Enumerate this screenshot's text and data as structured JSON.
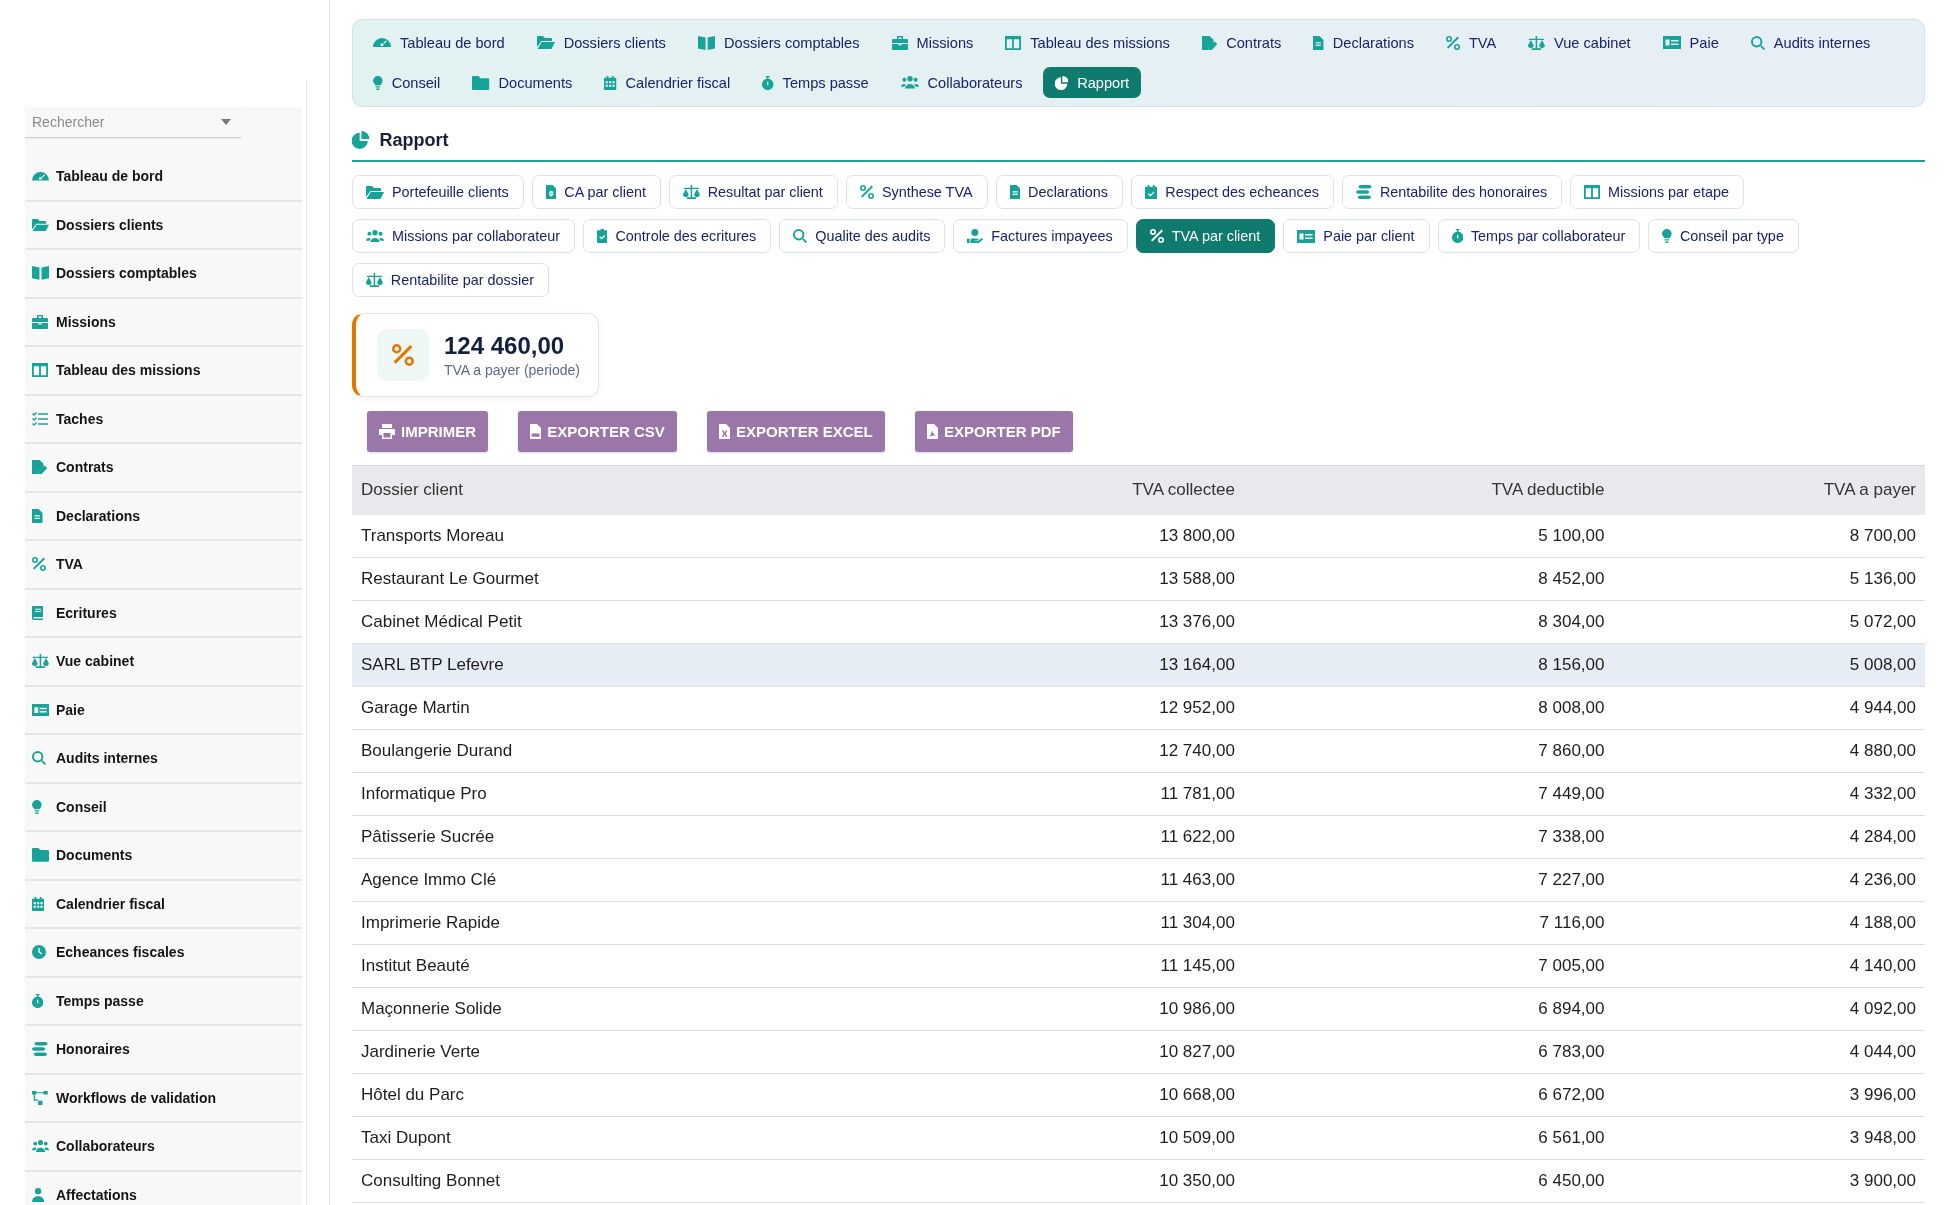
{
  "sidebar": {
    "search": {
      "placeholder": "Rechercher"
    },
    "items": [
      {
        "label": "Tableau de bord",
        "selected": false
      },
      {
        "label": "Dossiers clients",
        "selected": false
      },
      {
        "label": "Dossiers comptables",
        "selected": false
      },
      {
        "label": "Missions",
        "selected": false
      },
      {
        "label": "Tableau des missions",
        "selected": false
      },
      {
        "label": "Taches",
        "selected": false
      },
      {
        "label": "Contrats",
        "selected": false
      },
      {
        "label": "Declarations",
        "selected": false
      },
      {
        "label": "TVA",
        "selected": false
      },
      {
        "label": "Ecritures",
        "selected": false
      },
      {
        "label": "Vue cabinet",
        "selected": false
      },
      {
        "label": "Paie",
        "selected": false
      },
      {
        "label": "Audits internes",
        "selected": false
      },
      {
        "label": "Conseil",
        "selected": false
      },
      {
        "label": "Documents",
        "selected": false
      },
      {
        "label": "Calendrier fiscal",
        "selected": false
      },
      {
        "label": "Echeances fiscales",
        "selected": false
      },
      {
        "label": "Temps passe",
        "selected": false
      },
      {
        "label": "Honoraires",
        "selected": false
      },
      {
        "label": "Workflows de validation",
        "selected": false
      },
      {
        "label": "Collaborateurs",
        "selected": false
      },
      {
        "label": "Affectations",
        "selected": false
      }
    ]
  },
  "top_nav": {
    "items": [
      {
        "label": "Tableau de bord",
        "selected": false
      },
      {
        "label": "Dossiers clients",
        "selected": false
      },
      {
        "label": "Dossiers comptables",
        "selected": false
      },
      {
        "label": "Missions",
        "selected": false
      },
      {
        "label": "Tableau des missions",
        "selected": false
      },
      {
        "label": "Contrats",
        "selected": false
      },
      {
        "label": "Declarations",
        "selected": false
      },
      {
        "label": "TVA",
        "selected": false
      },
      {
        "label": "Vue cabinet",
        "selected": false
      },
      {
        "label": "Paie",
        "selected": false
      },
      {
        "label": "Audits internes",
        "selected": false
      },
      {
        "label": "Conseil",
        "selected": false
      },
      {
        "label": "Documents",
        "selected": false
      },
      {
        "label": "Calendrier fiscal",
        "selected": false
      },
      {
        "label": "Temps passe",
        "selected": false
      },
      {
        "label": "Collaborateurs",
        "selected": false
      },
      {
        "label": "Rapport",
        "selected": true
      }
    ]
  },
  "section": {
    "title": "Rapport"
  },
  "report_tabs": [
    {
      "label": "Portefeuille clients",
      "selected": false
    },
    {
      "label": "CA par client",
      "selected": false
    },
    {
      "label": "Resultat par client",
      "selected": false
    },
    {
      "label": "Synthese TVA",
      "selected": false
    },
    {
      "label": "Declarations",
      "selected": false
    },
    {
      "label": "Respect des echeances",
      "selected": false
    },
    {
      "label": "Rentabilite des honoraires",
      "selected": false
    },
    {
      "label": "Missions par etape",
      "selected": false
    },
    {
      "label": "Missions par collaborateur",
      "selected": false
    },
    {
      "label": "Controle des ecritures",
      "selected": false
    },
    {
      "label": "Qualite des audits",
      "selected": false
    },
    {
      "label": "Factures impayees",
      "selected": false
    },
    {
      "label": "TVA par client",
      "selected": true
    },
    {
      "label": "Paie par client",
      "selected": false
    },
    {
      "label": "Temps par collaborateur",
      "selected": false
    },
    {
      "label": "Conseil par type",
      "selected": false
    },
    {
      "label": "Rentabilite par dossier",
      "selected": false
    }
  ],
  "kpi": {
    "value": "124 460,00",
    "label": "TVA a payer (periode)"
  },
  "actions": [
    {
      "label": "IMPRIMER"
    },
    {
      "label": "EXPORTER CSV"
    },
    {
      "label": "EXPORTER EXCEL"
    },
    {
      "label": "EXPORTER PDF"
    }
  ],
  "table": {
    "columns": [
      "Dossier client",
      "TVA collectee",
      "TVA deductible",
      "TVA a payer"
    ],
    "rows": [
      {
        "cells": [
          "Transports Moreau",
          "13 800,00",
          "5 100,00",
          "8 700,00"
        ],
        "selected": false
      },
      {
        "cells": [
          "Restaurant Le Gourmet",
          "13 588,00",
          "8 452,00",
          "5 136,00"
        ],
        "selected": false
      },
      {
        "cells": [
          "Cabinet Médical Petit",
          "13 376,00",
          "8 304,00",
          "5 072,00"
        ],
        "selected": false
      },
      {
        "cells": [
          "SARL BTP Lefevre",
          "13 164,00",
          "8 156,00",
          "5 008,00"
        ],
        "selected": true
      },
      {
        "cells": [
          "Garage Martin",
          "12 952,00",
          "8 008,00",
          "4 944,00"
        ],
        "selected": false
      },
      {
        "cells": [
          "Boulangerie Durand",
          "12 740,00",
          "7 860,00",
          "4 880,00"
        ],
        "selected": false
      },
      {
        "cells": [
          "Informatique Pro",
          "11 781,00",
          "7 449,00",
          "4 332,00"
        ],
        "selected": false
      },
      {
        "cells": [
          "Pâtisserie Sucrée",
          "11 622,00",
          "7 338,00",
          "4 284,00"
        ],
        "selected": false
      },
      {
        "cells": [
          "Agence Immo Clé",
          "11 463,00",
          "7 227,00",
          "4 236,00"
        ],
        "selected": false
      },
      {
        "cells": [
          "Imprimerie Rapide",
          "11 304,00",
          "7 116,00",
          "4 188,00"
        ],
        "selected": false
      },
      {
        "cells": [
          "Institut Beauté",
          "11 145,00",
          "7 005,00",
          "4 140,00"
        ],
        "selected": false
      },
      {
        "cells": [
          "Maçonnerie Solide",
          "10 986,00",
          "6 894,00",
          "4 092,00"
        ],
        "selected": false
      },
      {
        "cells": [
          "Jardinerie Verte",
          "10 827,00",
          "6 783,00",
          "4 044,00"
        ],
        "selected": false
      },
      {
        "cells": [
          "Hôtel du Parc",
          "10 668,00",
          "6 672,00",
          "3 996,00"
        ],
        "selected": false
      },
      {
        "cells": [
          "Taxi Dupont",
          "10 509,00",
          "6 561,00",
          "3 948,00"
        ],
        "selected": false
      },
      {
        "cells": [
          "Consulting Bonnet",
          "10 350,00",
          "6 450,00",
          "3 900,00"
        ],
        "selected": false
      }
    ]
  }
}
